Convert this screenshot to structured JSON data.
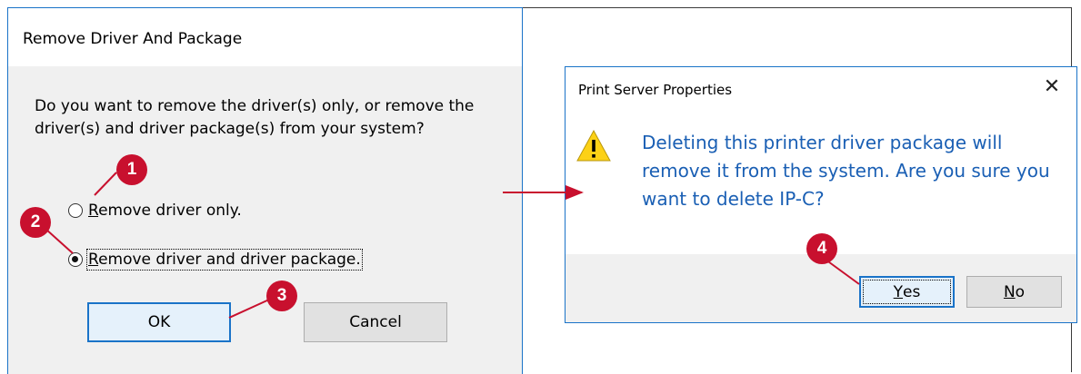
{
  "dialog_remove": {
    "title": "Remove Driver And Package",
    "question": "Do you want to remove the driver(s) only, or remove the driver(s) and driver package(s) from your system?",
    "option_driver_only": {
      "accel": "R",
      "rest": "emove driver only.",
      "selected": false
    },
    "option_driver_and_package": {
      "accel": "R",
      "rest": "emove driver and driver package.",
      "selected": true
    },
    "ok_label": "OK",
    "cancel_label": "Cancel"
  },
  "dialog_confirm": {
    "title": "Print Server Properties",
    "close_glyph": "✕",
    "icon": "warning-icon",
    "message": "Deleting this printer driver package will remove it from the system. Are you sure you want to delete IP-C?",
    "yes_accel": "Y",
    "yes_rest": "es",
    "no_accel": "N",
    "no_rest": "o"
  },
  "callouts": [
    "1",
    "2",
    "3",
    "4"
  ],
  "colors": {
    "callout": "#c8102e",
    "accent_blue": "#1a73c8",
    "message_blue": "#1a5fb4",
    "warning_yellow": "#fcd116"
  }
}
